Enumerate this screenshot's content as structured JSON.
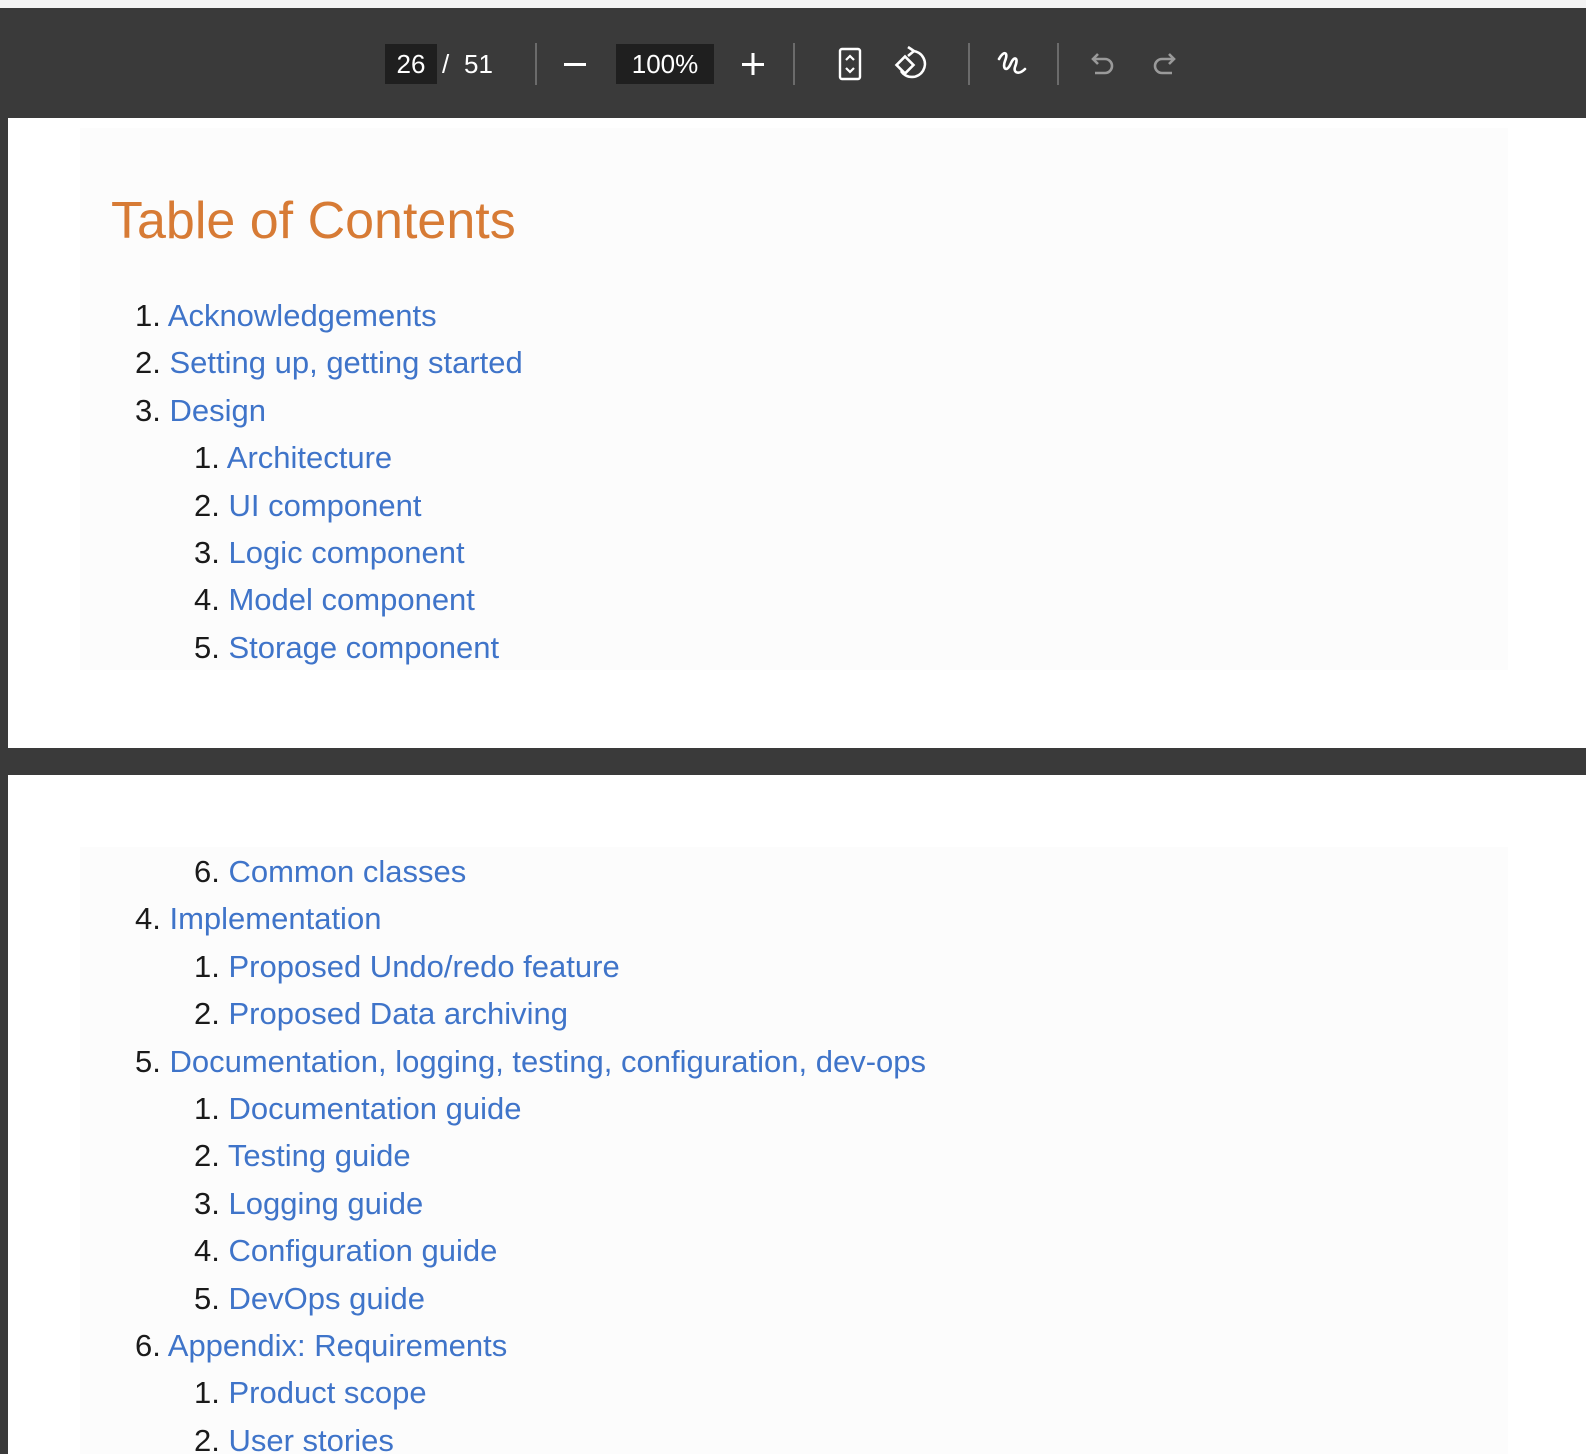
{
  "toolbar": {
    "current_page": "26",
    "separator": "/",
    "total_pages": "51",
    "zoom": "100%",
    "zoom_out_icon": "minus-icon",
    "zoom_in_icon": "plus-icon",
    "fit_icon": "fit-page-icon",
    "rotate_icon": "rotate-icon",
    "draw_icon": "draw-icon",
    "undo_icon": "undo-icon",
    "redo_icon": "redo-icon"
  },
  "colors": {
    "title": "#d77b35",
    "link": "#3f74c9",
    "toolbar_bg": "#3a3a3a"
  },
  "page1": {
    "title": "Table of Contents",
    "items": [
      {
        "num": "1.",
        "label": "Acknowledgements",
        "level": 1
      },
      {
        "num": "2.",
        "label": "Setting up, getting started",
        "level": 1
      },
      {
        "num": "3.",
        "label": "Design",
        "level": 1
      },
      {
        "num": "1.",
        "label": "Architecture",
        "level": 2
      },
      {
        "num": "2.",
        "label": "UI component",
        "level": 2
      },
      {
        "num": "3.",
        "label": "Logic component",
        "level": 2
      },
      {
        "num": "4.",
        "label": "Model component",
        "level": 2
      },
      {
        "num": "5.",
        "label": "Storage component",
        "level": 2
      }
    ]
  },
  "page2": {
    "items": [
      {
        "num": "6.",
        "label": "Common classes",
        "level": 2
      },
      {
        "num": "4.",
        "label": "Implementation",
        "level": 1
      },
      {
        "num": "1.",
        "label": "Proposed Undo/redo feature",
        "level": 2
      },
      {
        "num": "2.",
        "label": "Proposed Data archiving",
        "level": 2
      },
      {
        "num": "5.",
        "label": "Documentation, logging, testing, configuration, dev-ops",
        "level": 1
      },
      {
        "num": "1.",
        "label": "Documentation guide",
        "level": 2
      },
      {
        "num": "2.",
        "label": "Testing guide",
        "level": 2
      },
      {
        "num": "3.",
        "label": "Logging guide",
        "level": 2
      },
      {
        "num": "4.",
        "label": "Configuration guide",
        "level": 2
      },
      {
        "num": "5.",
        "label": "DevOps guide",
        "level": 2
      },
      {
        "num": "6.",
        "label": "Appendix: Requirements",
        "level": 1
      },
      {
        "num": "1.",
        "label": "Product scope",
        "level": 2
      },
      {
        "num": "2.",
        "label": "User stories",
        "level": 2
      }
    ]
  }
}
